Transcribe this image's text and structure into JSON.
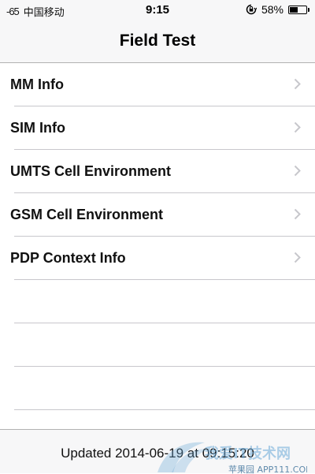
{
  "status_bar": {
    "signal": "-65",
    "carrier": "中国移动",
    "time": "9:15",
    "battery_percent_text": "58%",
    "battery_level": 0.58,
    "icons": [
      "rotation-lock-icon",
      "battery-icon"
    ]
  },
  "nav": {
    "title": "Field Test"
  },
  "list": {
    "items": [
      {
        "label": "MM Info"
      },
      {
        "label": "SIM Info"
      },
      {
        "label": "UMTS Cell Environment"
      },
      {
        "label": "GSM Cell Environment"
      },
      {
        "label": "PDP Context Info"
      }
    ]
  },
  "toolbar": {
    "updated_text": "Updated 2014-06-19 at 09:15:20"
  },
  "watermark": {
    "text_cn": "我爱IT技术网",
    "text_site": "苹果园 APP111.COM"
  },
  "colors": {
    "separator": "#c8c7cc",
    "bar_background": "#f7f7f8",
    "chevron": "#c7c7cc",
    "watermark": "#6aa9d8"
  }
}
